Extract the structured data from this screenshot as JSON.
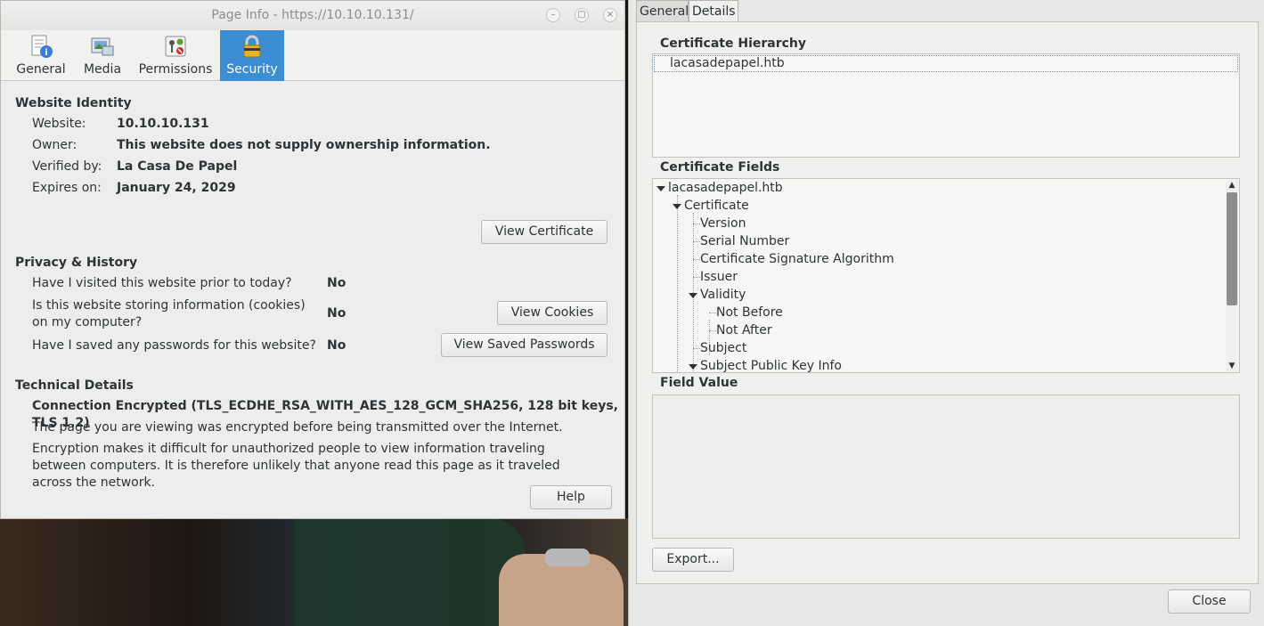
{
  "page_info": {
    "title": "Page Info - https://10.10.10.131/",
    "window_controls": {
      "minimize": "–",
      "maximize": "▢",
      "close": "×"
    },
    "tabs": [
      {
        "label": "General",
        "icon": "general-icon",
        "active": false
      },
      {
        "label": "Media",
        "icon": "media-icon",
        "active": false
      },
      {
        "label": "Permissions",
        "icon": "permissions-icon",
        "active": false
      },
      {
        "label": "Security",
        "icon": "lock-icon",
        "active": true
      }
    ],
    "website_identity": {
      "heading": "Website Identity",
      "rows": [
        {
          "label": "Website:",
          "value": "10.10.10.131"
        },
        {
          "label": "Owner:",
          "value": "This website does not supply ownership information."
        },
        {
          "label": "Verified by:",
          "value": "La Casa De Papel"
        },
        {
          "label": "Expires on:",
          "value": "January 24, 2029"
        }
      ],
      "view_certificate_button": "View Certificate"
    },
    "privacy_history": {
      "heading": "Privacy & History",
      "questions": [
        {
          "q": "Have I visited this website prior to today?",
          "a": "No"
        },
        {
          "q": "Is this website storing information (cookies) on my computer?",
          "a": "No"
        },
        {
          "q": "Have I saved any passwords for this website?",
          "a": "No"
        }
      ],
      "view_cookies_button": "View Cookies",
      "view_saved_passwords_button": "View Saved Passwords"
    },
    "technical_details": {
      "heading": "Technical Details",
      "connection": "Connection Encrypted (TLS_ECDHE_RSA_WITH_AES_128_GCM_SHA256, 128 bit keys, TLS 1.2)",
      "line1": "The page you are viewing was encrypted before being transmitted over the Internet.",
      "line2": "Encryption makes it difficult for unauthorized people to view information traveling between computers. It is therefore unlikely that anyone read this page as it traveled across the network."
    },
    "help_button": "Help"
  },
  "cert_viewer": {
    "tabs": [
      {
        "label": "General",
        "active": false
      },
      {
        "label": "Details",
        "active": true
      }
    ],
    "hierarchy_label": "Certificate Hierarchy",
    "hierarchy_items": [
      "lacasadepapel.htb"
    ],
    "fields_label": "Certificate Fields",
    "fields_tree": [
      {
        "label": "lacasadepapel.htb",
        "level": 0,
        "expanded": true
      },
      {
        "label": "Certificate",
        "level": 1,
        "expanded": true
      },
      {
        "label": "Version",
        "level": 2
      },
      {
        "label": "Serial Number",
        "level": 2
      },
      {
        "label": "Certificate Signature Algorithm",
        "level": 2
      },
      {
        "label": "Issuer",
        "level": 2
      },
      {
        "label": "Validity",
        "level": 2,
        "expanded": true
      },
      {
        "label": "Not Before",
        "level": 3
      },
      {
        "label": "Not After",
        "level": 3
      },
      {
        "label": "Subject",
        "level": 2
      },
      {
        "label": "Subject Public Key Info",
        "level": 2,
        "expanded": true
      }
    ],
    "field_value_label": "Field Value",
    "field_value": "",
    "export_button": "Export...",
    "close_button": "Close"
  }
}
